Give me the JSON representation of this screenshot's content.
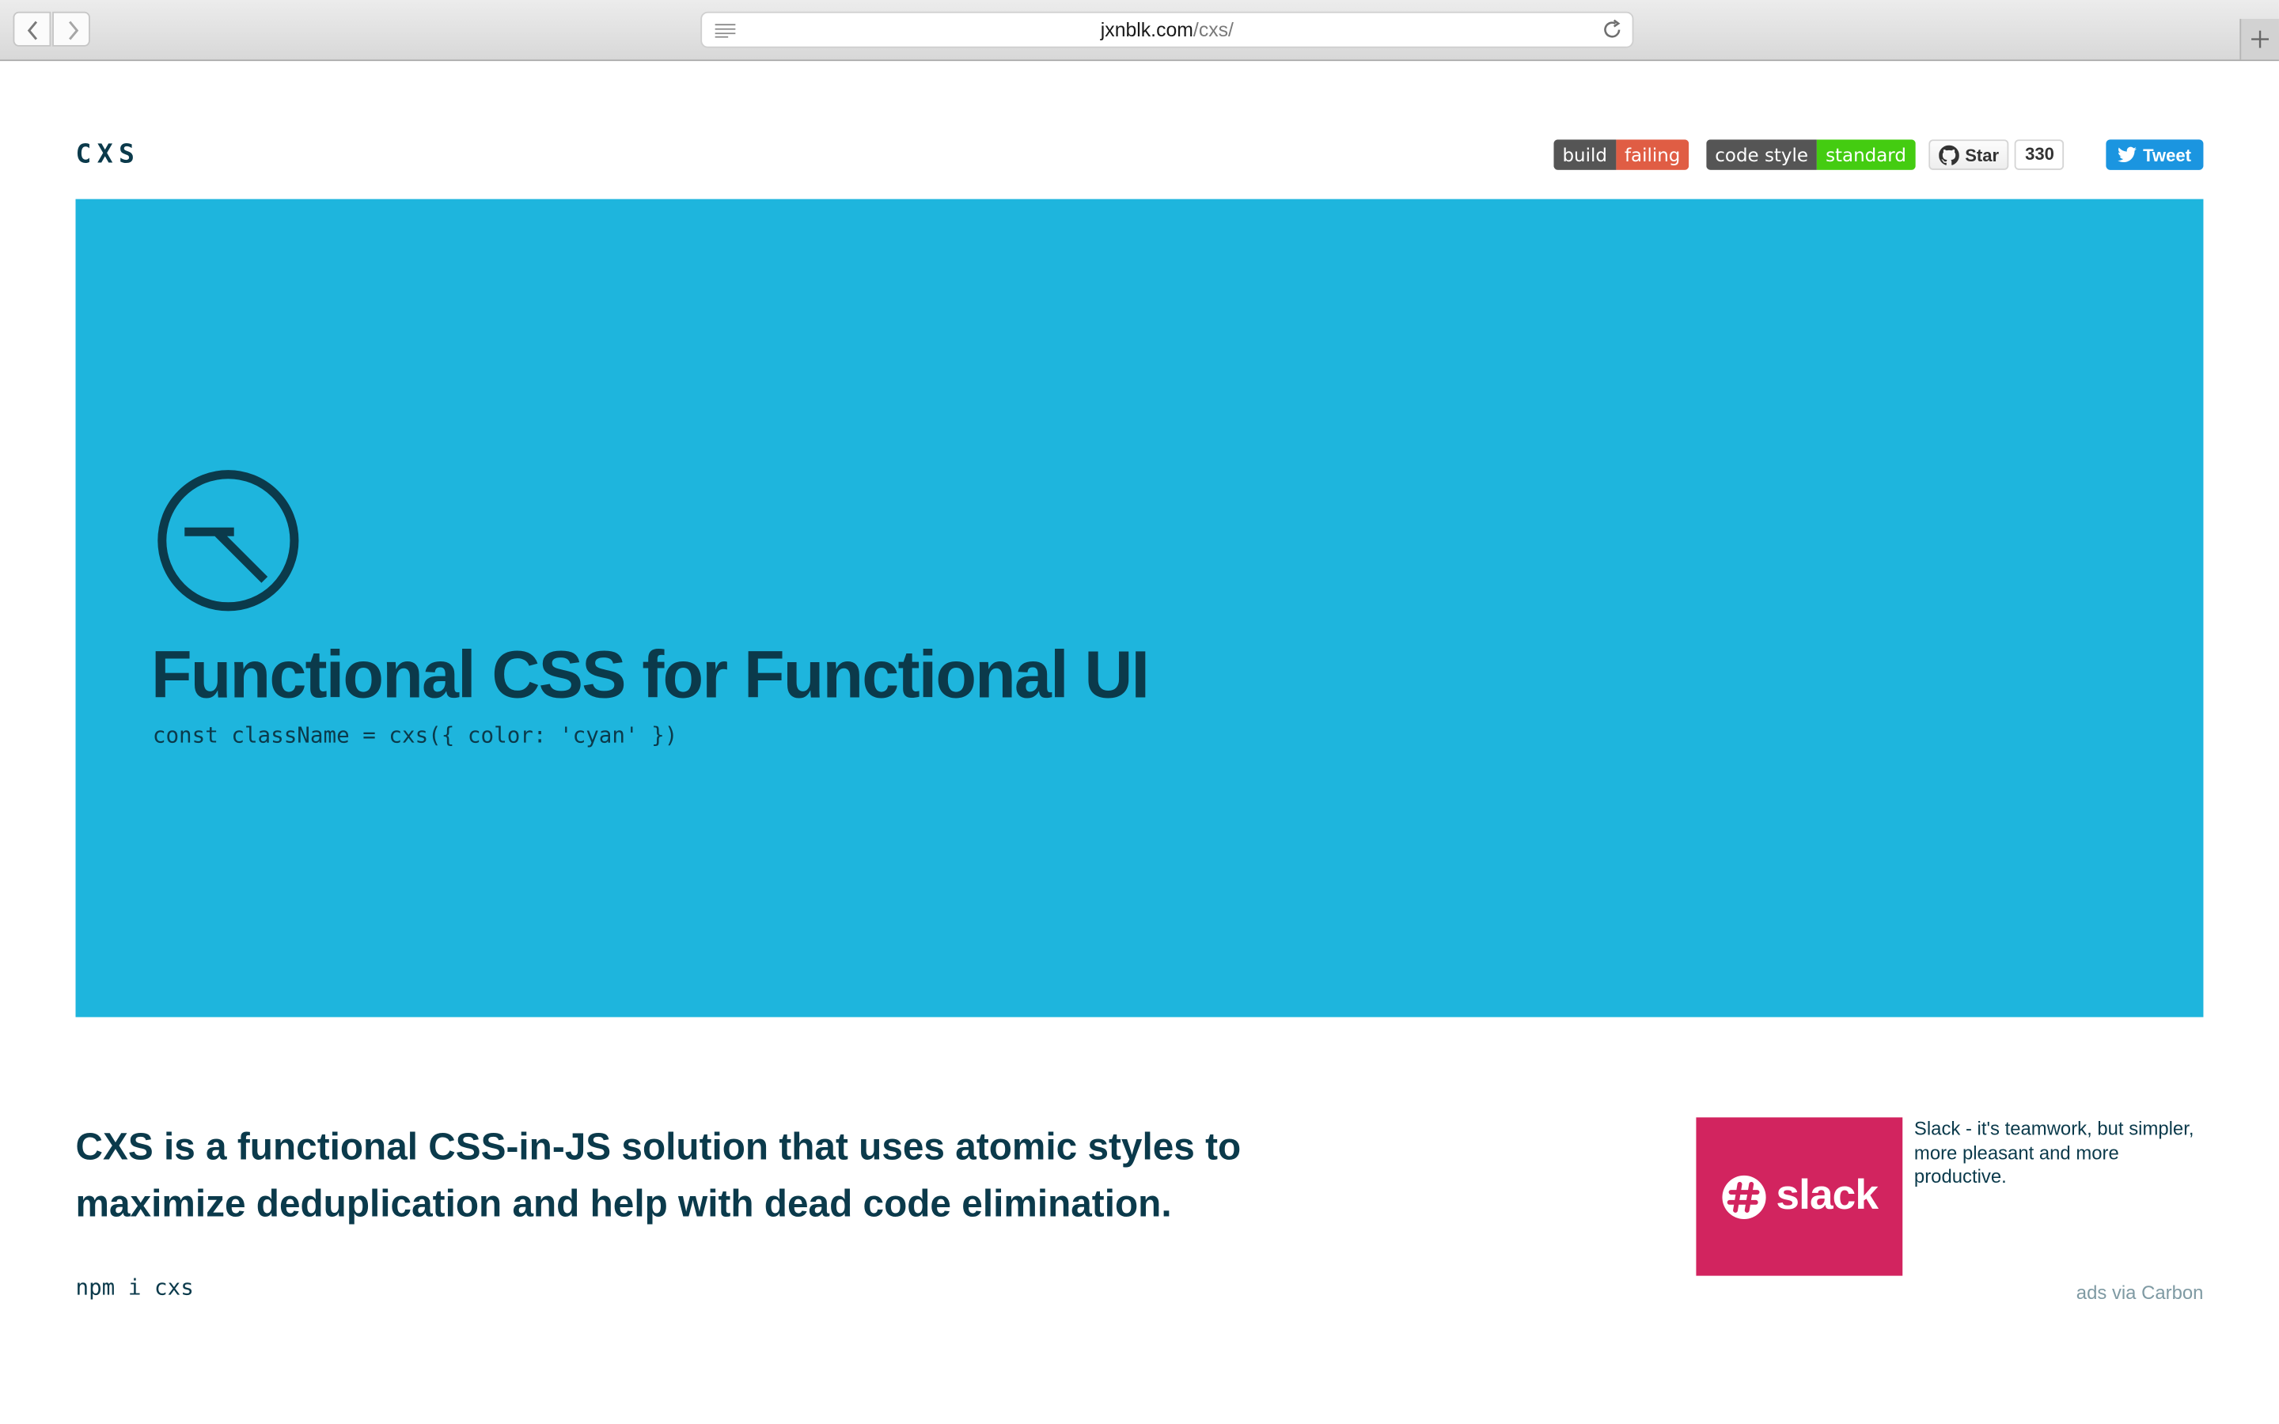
{
  "browser": {
    "url_domain": "jxnblk.com",
    "url_path": "/cxs/"
  },
  "header": {
    "logo": "CXS",
    "badges": [
      {
        "left": "build",
        "right": "failing",
        "color": "#e05d44"
      },
      {
        "left": "code style",
        "right": "standard",
        "color": "#44cc11"
      }
    ],
    "github_star_label": "Star",
    "github_star_count": "330",
    "tweet_label": "Tweet"
  },
  "hero": {
    "background": "#1eb5dd",
    "title": "Functional CSS for Functional UI",
    "code": "const className = cxs({ color: 'cyan' })"
  },
  "intro": {
    "lead": "CXS is a functional CSS-in-JS solution that uses atomic styles to maximize deduplication and help with dead code elimination.",
    "install": "npm i cxs"
  },
  "ad": {
    "brand": "slack",
    "brand_color": "#d2245f",
    "text": "Slack - it's teamwork, but simpler, more pleasant and more productive.",
    "via": "ads via Carbon"
  }
}
